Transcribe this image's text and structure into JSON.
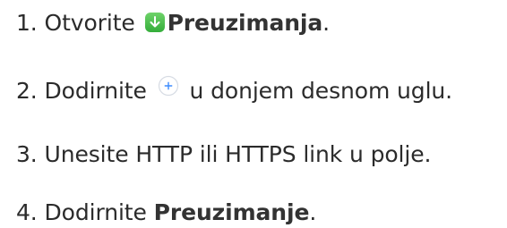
{
  "steps": [
    {
      "number": "1.",
      "text_before": "Otvorite",
      "bold": "Preuzimanja",
      "text_after": "."
    },
    {
      "number": "2.",
      "text_before": "Dodirnite",
      "text_after": "u donjem desnom uglu."
    },
    {
      "number": "3.",
      "text": "Unesite HTTP ili HTTPS link u polje."
    },
    {
      "number": "4.",
      "text_before": "Dodirnite",
      "bold": "Preuzimanje",
      "text_after": "."
    }
  ],
  "icons": {
    "downloads_app": "download-app-icon",
    "add_button": "plus-circle-icon"
  },
  "colors": {
    "downloads_icon_green": "#4cc24c",
    "add_icon_blue": "#3d8bfd",
    "text": "#2b2b2b"
  }
}
